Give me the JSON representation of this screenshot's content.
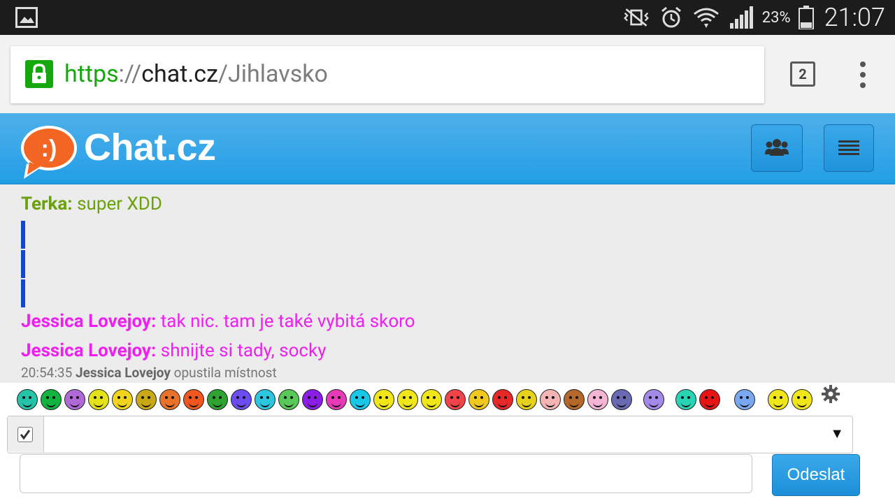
{
  "status_bar": {
    "battery_percent": "23%",
    "time": "21:07",
    "icons": [
      "image-icon",
      "vibrate-silent-icon",
      "alarm-icon",
      "wifi-icon",
      "signal-icon",
      "battery-icon"
    ]
  },
  "browser": {
    "url_scheme": "https",
    "url_sep": "://",
    "url_host": "chat.cz",
    "url_path": "/Jihlavsko",
    "tab_count": "2",
    "colors": {
      "secure": "#14a80e"
    }
  },
  "app": {
    "title": "Chat.cz",
    "logo_text": ":)",
    "colors": {
      "header": "#229ee6",
      "logo": "#f26522"
    }
  },
  "chat": {
    "messages": [
      {
        "author": "Terka:",
        "text": " super XDD",
        "color": "#6aa10c"
      },
      {
        "author": "Jessica Lovejoy:",
        "text": " tak nic. tam je také vybitá skoro",
        "color": "#ee1ff0"
      },
      {
        "author": "Jessica Lovejoy:",
        "text": " shnijte si tady, socky",
        "color": "#ee1ff0"
      }
    ],
    "system": {
      "time": "20:54:35",
      "user": "Jessica Lovejoy",
      "text": " opustila místnost"
    }
  },
  "emoticons": [
    "#23c4a8",
    "#12b33e",
    "#b06ad8",
    "#e6e21a",
    "#f0d41e",
    "#c9a816",
    "#e8722a",
    "#f0561e",
    "#2fa32f",
    "#6a4cf0",
    "#2cc6e0",
    "#58c858",
    "#8a1ee6",
    "#e63ab6",
    "#18c8e8",
    "#f0e61a",
    "#f0e61a",
    "#f0e61a",
    "#f0444a",
    "#f0c81e",
    "#e62828",
    "#e6d21a",
    "#f4b4b4",
    "#b4682a",
    "#f4b4d4",
    "#6a6ab4",
    "#a48ae8",
    "#28d4b4",
    "#e61414",
    "#7aa8f0",
    "#f0e61a",
    "#f0e61a"
  ],
  "composer": {
    "select_value": "",
    "message_value": "",
    "send_label": "Odeslat"
  }
}
